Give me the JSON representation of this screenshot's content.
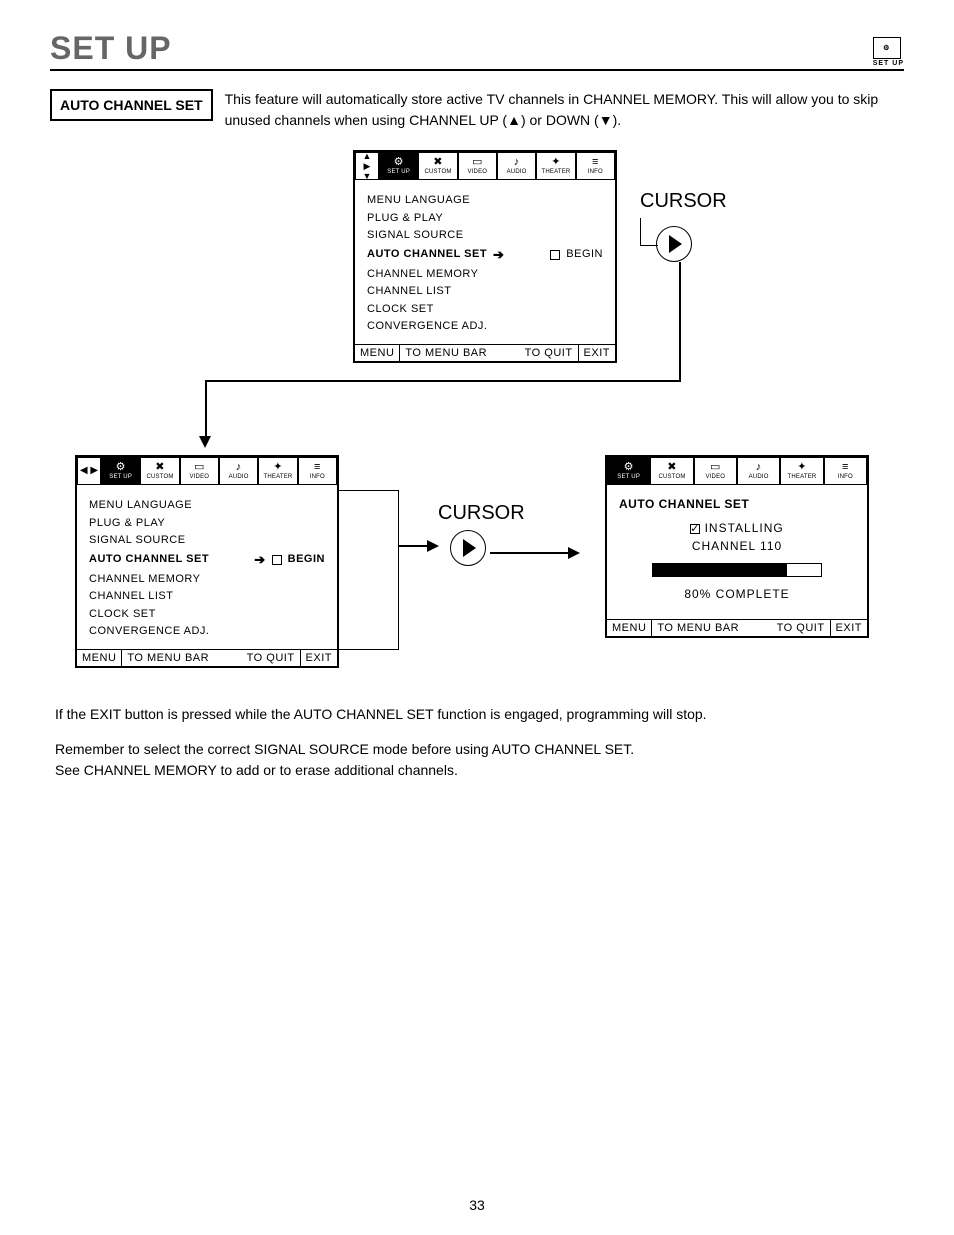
{
  "header": {
    "title": "SET UP",
    "corner_label": "SET UP"
  },
  "intro": {
    "box_label": "AUTO CHANNEL SET",
    "text": "This feature will automatically store active TV channels in CHANNEL MEMORY.  This will allow you to skip unused channels when using CHANNEL UP (▲) or DOWN (▼)."
  },
  "tabs": [
    "SET UP",
    "CUSTOM",
    "VIDEO",
    "AUDIO",
    "THEATER",
    "INFO"
  ],
  "menu_items": [
    "MENU LANGUAGE",
    "PLUG & PLAY",
    "SIGNAL SOURCE",
    "AUTO CHANNEL SET",
    "CHANNEL MEMORY",
    "CHANNEL LIST",
    "CLOCK SET",
    "CONVERGENCE ADJ."
  ],
  "begin_label": "BEGIN",
  "osd_footer": {
    "menu": "MENU",
    "menubar": "TO MENU BAR",
    "quit": "TO QUIT",
    "exit": "EXIT"
  },
  "cursor_label": "CURSOR",
  "install": {
    "title": "AUTO CHANNEL SET",
    "line1": "INSTALLING",
    "line2": "CHANNEL 110",
    "complete": "80% COMPLETE",
    "progress_pct": 80
  },
  "footnotes": {
    "p1": "If the EXIT button is pressed while the AUTO CHANNEL SET function is engaged, programming will stop.",
    "p2": "Remember to select the correct SIGNAL SOURCE mode before using AUTO CHANNEL SET.",
    "p3": "See CHANNEL MEMORY to add or to erase additional channels."
  },
  "page_number": "33"
}
